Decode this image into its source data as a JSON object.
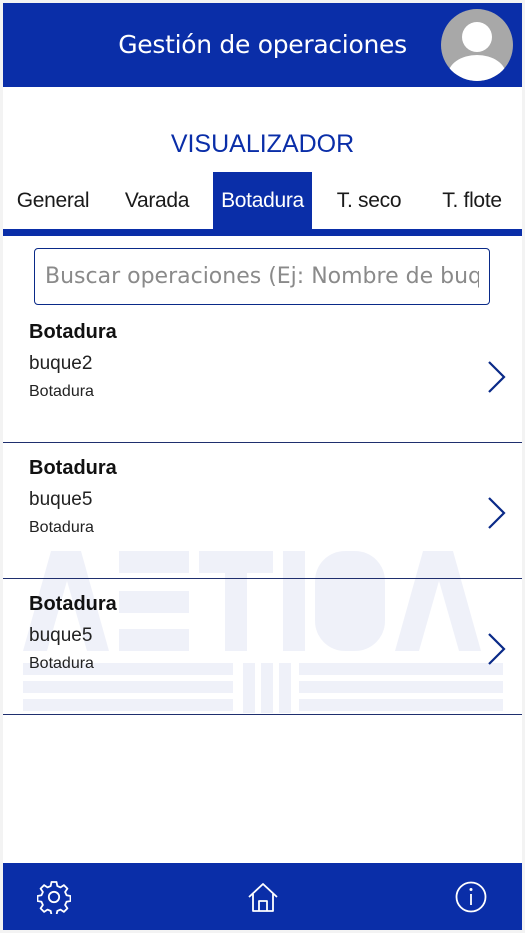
{
  "header": {
    "title": "Gestión de operaciones",
    "avatar_icon": "user-avatar-icon"
  },
  "section": {
    "title": "VISUALIZADOR"
  },
  "tabs": [
    {
      "label": "General",
      "active": false
    },
    {
      "label": "Varada",
      "active": false
    },
    {
      "label": "Botadura",
      "active": true
    },
    {
      "label": "T. seco",
      "active": false
    },
    {
      "label": "T. flote",
      "active": false
    }
  ],
  "search": {
    "placeholder": "Buscar operaciones (Ej: Nombre de buque)",
    "value": ""
  },
  "operations": [
    {
      "title": "Botadura",
      "vessel": "buque2",
      "type": "Botadura"
    },
    {
      "title": "Botadura",
      "vessel": "buque5",
      "type": "Botadura"
    },
    {
      "title": "Botadura",
      "vessel": "buque5",
      "type": "Botadura"
    }
  ],
  "footer": {
    "icons": [
      "gear-icon",
      "home-icon",
      "info-icon"
    ]
  },
  "colors": {
    "primary": "#0a2ea8",
    "background": "#ffffff",
    "divider": "#1f2f6e"
  }
}
